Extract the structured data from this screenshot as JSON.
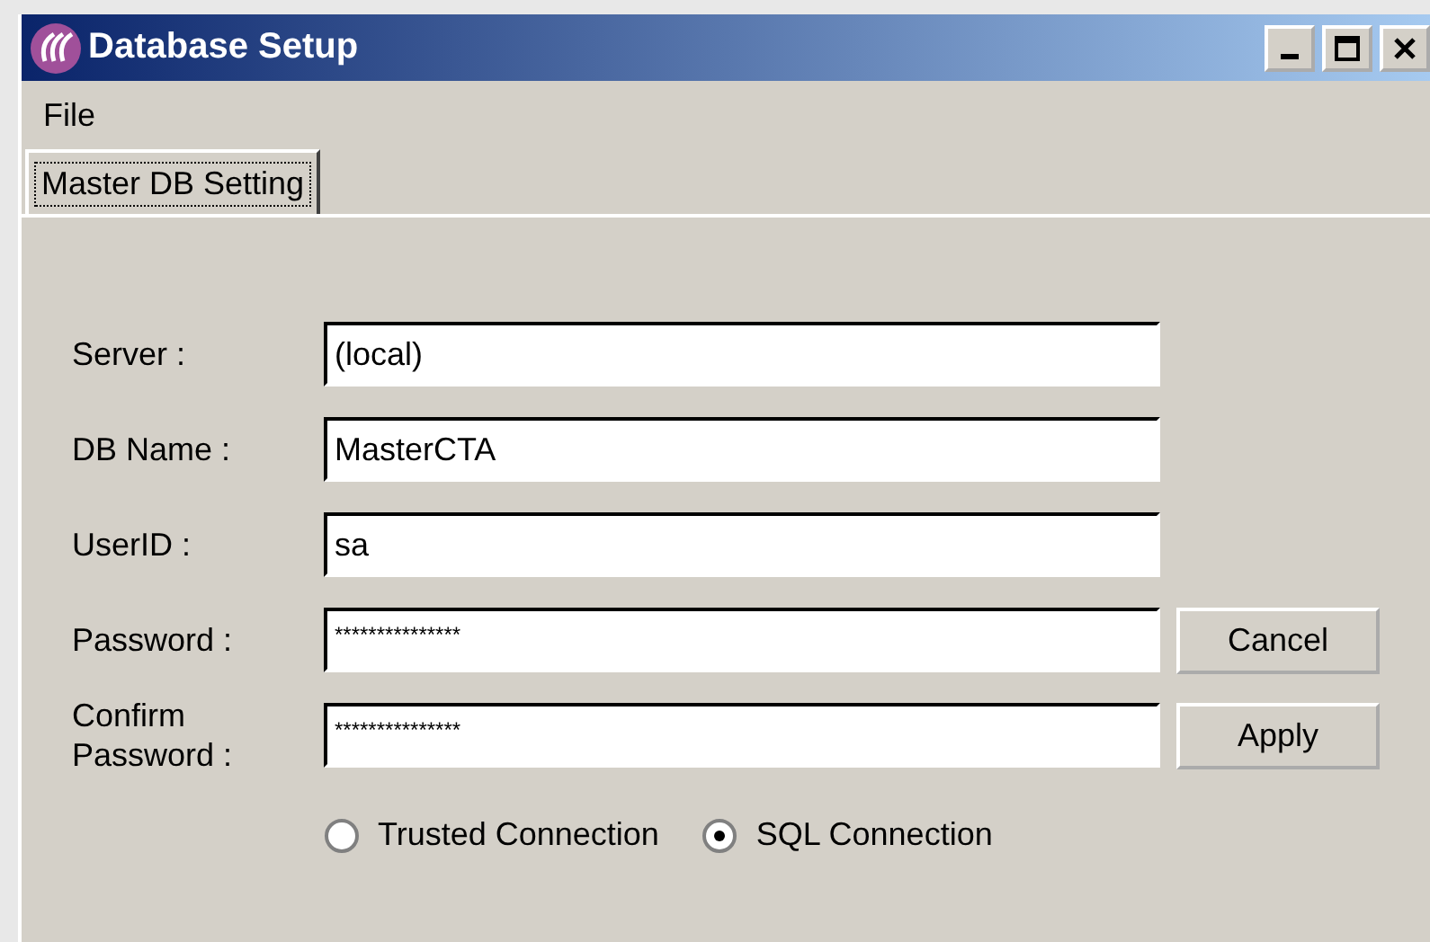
{
  "window": {
    "title": "Database Setup"
  },
  "menu": [
    "File"
  ],
  "tabs": [
    {
      "label": "Master DB Setting",
      "selected": true
    }
  ],
  "fields": [
    {
      "label": "Server :",
      "value": "(local)"
    },
    {
      "label": "DB Name :",
      "value": "MasterCTA"
    },
    {
      "label": "UserID :",
      "value": "sa"
    },
    {
      "label": "Password :",
      "value": "***************",
      "button": "Cancel"
    },
    {
      "label": "Confirm Password :",
      "value": "***************",
      "button": "Apply"
    }
  ],
  "connection": [
    {
      "label": "Trusted Connection",
      "selected": false
    },
    {
      "label": "SQL Connection",
      "selected": true
    }
  ]
}
